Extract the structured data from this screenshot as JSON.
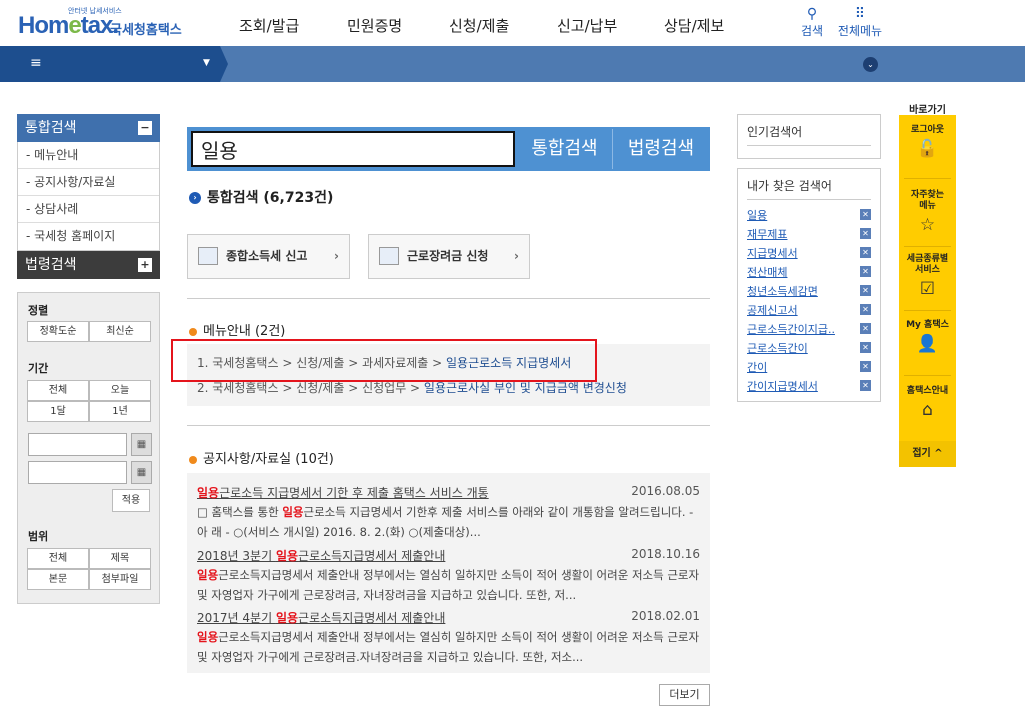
{
  "header": {
    "logo_tag": "안터넷 납세서비스",
    "logo_home": "Hom",
    "logo_e": "e",
    "logo_tax": "tax.",
    "logo_nts": "국세청홈택스",
    "nav": [
      "조회/발급",
      "민원증명",
      "신청/제출",
      "신고/납부",
      "상담/제보"
    ],
    "search_label": "검색",
    "allmenu_label": "전체메뉴"
  },
  "bar": {
    "menu_icon": "≡",
    "caret": "▼",
    "down_icon": "⌄"
  },
  "sidebar": {
    "total_search": "통합검색",
    "total_toggle": "−",
    "items": [
      "- 메뉴안내",
      "- 공지사항/자료실",
      "- 상담사례",
      "- 국세청 홈페이지"
    ],
    "law_search": "법령검색",
    "law_toggle": "+"
  },
  "filter": {
    "sort_title": "정렬",
    "sort": [
      "정확도순",
      "최신순"
    ],
    "period_title": "기간",
    "period": [
      "전체",
      "오늘",
      "1달",
      "1년"
    ],
    "calendar_icon": "▦",
    "apply": "적용",
    "scope_title": "범위",
    "scope": [
      "전체",
      "제목",
      "본문",
      "첨부파일"
    ]
  },
  "search": {
    "value": "일용",
    "total_button": "통합검색",
    "law_button": "법령검색"
  },
  "results": {
    "total_heading": "통합검색 (6,723건)",
    "quick": [
      "종합소득세 신고",
      "근로장려금 신청"
    ],
    "quick_arrow": "›",
    "menu_heading": "메뉴안내 (2건)",
    "menu_paths": [
      {
        "path": "1. 국세청홈택스 > 신청/제출 > 과세자료제출 > ",
        "target": "일용근로소득 지급명세서"
      },
      {
        "path": "2. 국세청홈택스 > 신청/제출 > 신청업무 > ",
        "target": "일용근로사실 부인 및 지급금액 변경신청"
      }
    ],
    "notice_heading": "공지사항/자료실 (10건)",
    "notices": [
      {
        "title_hl": "일용",
        "title_rest": "근로소득 지급명세서 기한 후 제출 홈택스 서비스 개통",
        "date": "2016.08.05",
        "body_pre": "□ 홈택스를 통한 ",
        "body_hl": "일용",
        "body_post": "근로소득 지급명세서 기한후 제출 서비스를 아래와 같이 개통함을 알려드립니다. - 아 래 - ○(서비스 개시일) 2016. 8. 2.(화) ○(제출대상)..."
      },
      {
        "title_pre": "2018년 3분기 ",
        "title_hl": "일용",
        "title_rest": "근로소득지급명세서 제출안내",
        "date": "2018.10.16",
        "body_pre": "",
        "body_hl": "일용",
        "body_post": "근로소득지급명세서 제출안내 정부에서는 열심히 일하지만 소득이 적어 생활이 어려운 저소득 근로자 및 자영업자 가구에게 근로장려금, 자녀장려금을 지급하고 있습니다. 또한, 저..."
      },
      {
        "title_pre": "2017년 4분기 ",
        "title_hl": "일용",
        "title_rest": "근로소득지급명세서 제출안내",
        "date": "2018.02.01",
        "body_pre": "",
        "body_hl": "일용",
        "body_post": "근로소득지급명세서 제출안내 정부에서는 열심히 일하지만 소득이 적어 생활이 어려운 저소득 근로자 및 자영업자 가구에게 근로장려금.자녀장려금을 지급하고 있습니다. 또한, 저소..."
      }
    ],
    "more_button": "더보기"
  },
  "popular": {
    "title": "인기검색어"
  },
  "my_keywords": {
    "title": "내가 찾은 검색어",
    "remove_icon": "✕",
    "items": [
      "일용",
      "재무제표",
      "지급명세서",
      "전산매체",
      "청년소득세감면",
      "공제신고서",
      "근로소득간이지급..",
      "근로소득간이",
      "간이",
      "간이지급명세서"
    ]
  },
  "quickbar": {
    "title": "바로가기",
    "items": [
      {
        "label": "로그아웃",
        "icon": "🔓"
      },
      {
        "label": "자주찾는\n메뉴",
        "icon": "☆"
      },
      {
        "label": "세금종류별\n서비스",
        "icon": "☑"
      },
      {
        "label": "My 홈택스",
        "icon": "👤"
      },
      {
        "label": "홈택스안내",
        "icon": "⌂"
      }
    ],
    "fold": "접기 ^"
  },
  "colors": {
    "brand_blue": "#2a62b5",
    "nav_bar": "#4e7ab1",
    "highlight_red": "#e4141c",
    "quickbar_yellow": "#ffcc00"
  }
}
